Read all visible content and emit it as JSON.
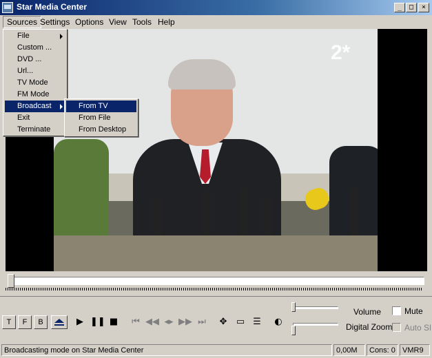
{
  "window": {
    "title": "Star Media Center"
  },
  "menubar": [
    "Sources",
    "Settings",
    "Options",
    "View",
    "Tools",
    "Help"
  ],
  "sources_menu": {
    "items": [
      {
        "label": "File",
        "submenu": true
      },
      {
        "label": "Custom ...",
        "submenu": false
      },
      {
        "label": "DVD ...",
        "submenu": false
      },
      {
        "label": "Url...",
        "submenu": false
      },
      {
        "label": "TV Mode",
        "submenu": false
      },
      {
        "label": "FM Mode",
        "submenu": false
      },
      {
        "label": "Broadcast",
        "submenu": true,
        "highlighted": true
      },
      {
        "label": "Exit",
        "submenu": false
      },
      {
        "label": "Terminate",
        "submenu": false
      }
    ]
  },
  "broadcast_submenu": {
    "items": [
      {
        "label": "From TV",
        "highlighted": true
      },
      {
        "label": "From File"
      },
      {
        "label": "From Desktop"
      }
    ]
  },
  "video": {
    "channel_logo": "2*"
  },
  "controls": {
    "mode_buttons": [
      "T",
      "F",
      "B"
    ],
    "volume_label": "Volume",
    "digital_zoom_label": "Digital Zoom",
    "mute_label": "Mute",
    "auto_sd_label": "Auto SD"
  },
  "icons": [
    "eject-icon",
    "play-icon",
    "pause-icon",
    "stop-icon",
    "skip-start-icon",
    "rewind-icon",
    "step-icon",
    "fast-forward-icon",
    "skip-end-icon",
    "move-icon",
    "monitor-icon",
    "playlist-icon",
    "brightness-contrast-icon"
  ],
  "statusbar": {
    "message": "Broadcasting mode on Star Media Center",
    "size": "0,00M",
    "cons": "Cons: 0",
    "renderer": "VMR9"
  },
  "colors": {
    "highlight": "#0a246a",
    "face": "#d4d0c8"
  }
}
